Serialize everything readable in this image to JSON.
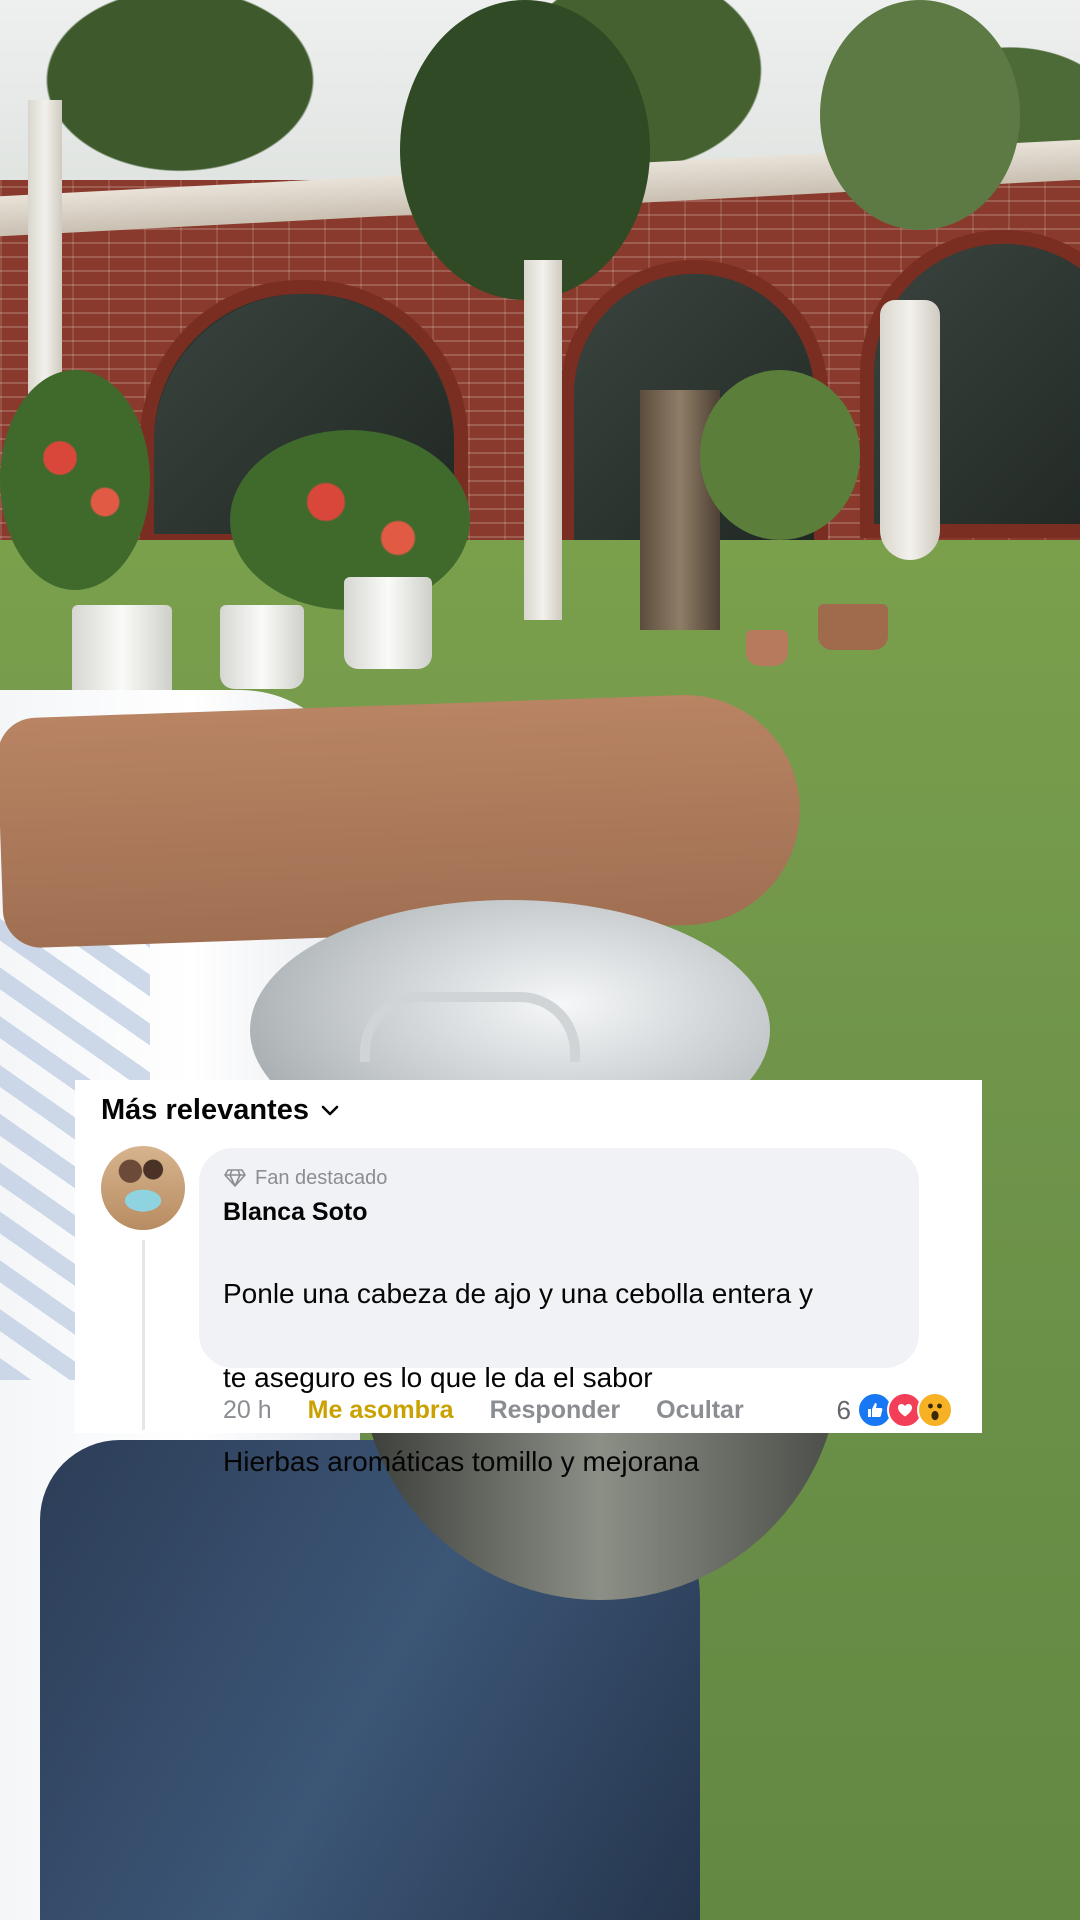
{
  "comments_section": {
    "sort_label": "Más relevantes",
    "sort_icon": "chevron-down-icon"
  },
  "comment": {
    "avatar_icon": "user-avatar",
    "badge_icon": "diamond-icon",
    "badge": "Fan destacado",
    "author": "Blanca Soto",
    "lines": [
      "Ponle una cabeza de ajo y una cebolla entera y",
      "te aseguro es lo que le da el sabor",
      "Hierbas aromáticas tomillo y mejorana"
    ],
    "time": "20 h",
    "reaction_label": "Me asombra",
    "reply_label": "Responder",
    "hide_label": "Ocultar",
    "reaction_count": "6",
    "reactions": [
      "like",
      "love",
      "wow"
    ]
  },
  "colors": {
    "reacted_accent": "#c9a100",
    "like": "#1877f2",
    "love": "#f33e58",
    "wow": "#f7b125",
    "muted_text": "#8a8d91"
  }
}
